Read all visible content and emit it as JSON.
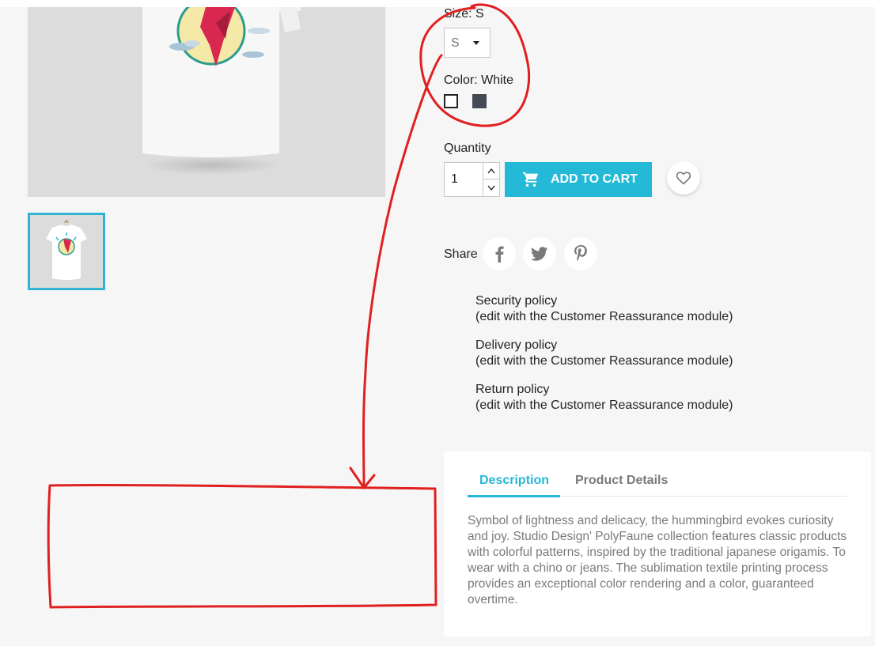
{
  "product": {
    "size_label": "Size: S",
    "size_value": "S",
    "color_label": "Color: White",
    "swatches": [
      {
        "name": "White",
        "hex": "#ffffff"
      },
      {
        "name": "Grey",
        "hex": "#434a54"
      }
    ],
    "quantity_label": "Quantity",
    "quantity_value": "1",
    "add_to_cart_label": "ADD TO CART",
    "share_label": "Share"
  },
  "reassurance": [
    {
      "title": "Security policy",
      "subtitle": "(edit with the Customer Reassurance module)"
    },
    {
      "title": "Delivery policy",
      "subtitle": "(edit with the Customer Reassurance module)"
    },
    {
      "title": "Return policy",
      "subtitle": "(edit with the Customer Reassurance module)"
    }
  ],
  "tabs": {
    "description": "Description",
    "details": "Product Details"
  },
  "description_text": "Symbol of lightness and delicacy, the hummingbird evokes curiosity and joy. Studio Design' PolyFaune collection features classic products with colorful patterns, inspired by the traditional japanese origamis. To wear with a chino or jeans. The sublimation textile printing process provides an exceptional color rendering and a color, guaranteed overtime.",
  "colors": {
    "accent": "#24b9d7",
    "annotation": "#e02020",
    "background": "#f6f6f6"
  },
  "icons": [
    "cart-icon",
    "heart-icon",
    "facebook-icon",
    "twitter-icon",
    "pinterest-icon",
    "chevron-up-icon",
    "chevron-down-icon"
  ]
}
